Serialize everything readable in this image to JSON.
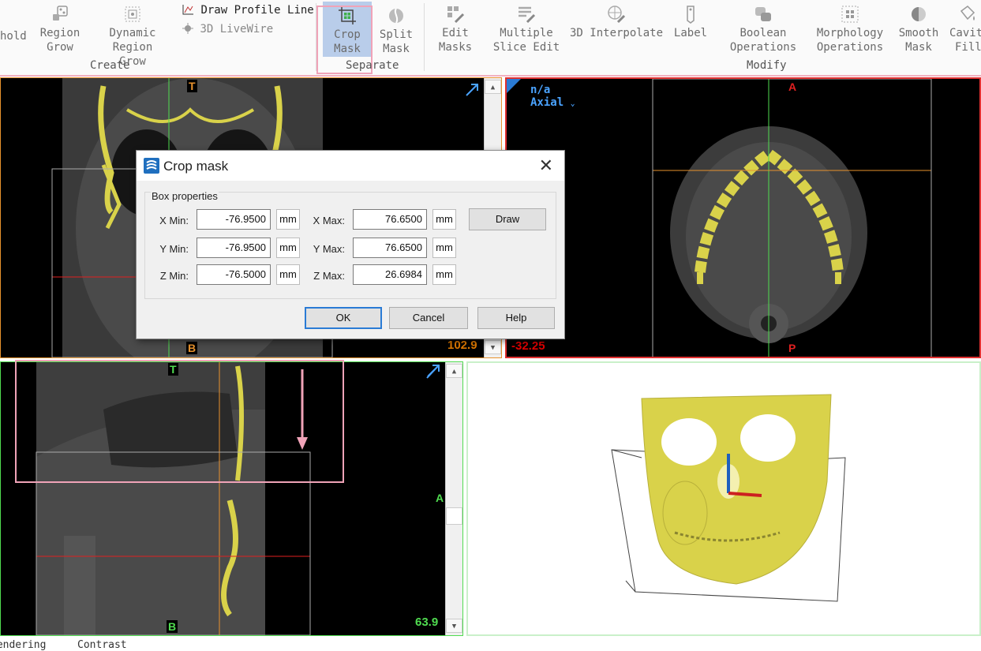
{
  "ribbon": {
    "threshold_partial": "hold",
    "region_grow": [
      "Region",
      "Grow"
    ],
    "dynamic_region_grow": [
      "Dynamic Region",
      "Grow"
    ],
    "draw_profile_line": "Draw Profile Line",
    "livewire_3d": "3D LiveWire",
    "create_group": "Create",
    "crop_mask": [
      "Crop",
      "Mask"
    ],
    "split_mask": [
      "Split",
      "Mask"
    ],
    "separate_group": "Separate",
    "edit_masks": [
      "Edit",
      "Masks"
    ],
    "multiple_slice_edit": [
      "Multiple",
      "Slice Edit"
    ],
    "interpolate_3d": "3D Interpolate",
    "label": "Label",
    "boolean_operations": [
      "Boolean",
      "Operations"
    ],
    "morphology_operations": [
      "Morphology",
      "Operations"
    ],
    "smooth_mask": [
      "Smooth",
      "Mask"
    ],
    "cavity_fill_partial": [
      "Cavit",
      "Fill"
    ],
    "modify_group": "Modify"
  },
  "views": {
    "coronal": {
      "top": "T",
      "bottom": "B",
      "value": "102.9",
      "value_color": "#e07a00"
    },
    "axial": {
      "na": "n/a",
      "orientation": "Axial",
      "top": "A",
      "bottom": "P",
      "value": "-32.25",
      "value_color": "#e00000"
    },
    "sagittal": {
      "top": "T",
      "bottom": "B",
      "right": "A",
      "value": "63.9",
      "value_color": "#50dc50"
    }
  },
  "dialog": {
    "title": "Crop mask",
    "group_title": "Box properties",
    "x_min_label": "X Min:",
    "x_min": "-76.9500",
    "x_max_label": "X Max:",
    "x_max": "76.6500",
    "y_min_label": "Y Min:",
    "y_min": "-76.9500",
    "y_max_label": "Y Max:",
    "y_max": "76.6500",
    "z_min_label": "Z Min:",
    "z_min": "-76.5000",
    "z_max_label": "Z Max:",
    "z_max": "26.6984",
    "unit": "mm",
    "draw_button": "Draw",
    "ok_button": "OK",
    "cancel_button": "Cancel",
    "help_button": "Help"
  },
  "status": {
    "rendering": "Rendering",
    "contrast": "Contrast"
  },
  "colors": {
    "mask_yellow": "#d9d24a",
    "annotation_pink": "#f0a3b8",
    "accent_blue": "#2a7bd5"
  }
}
